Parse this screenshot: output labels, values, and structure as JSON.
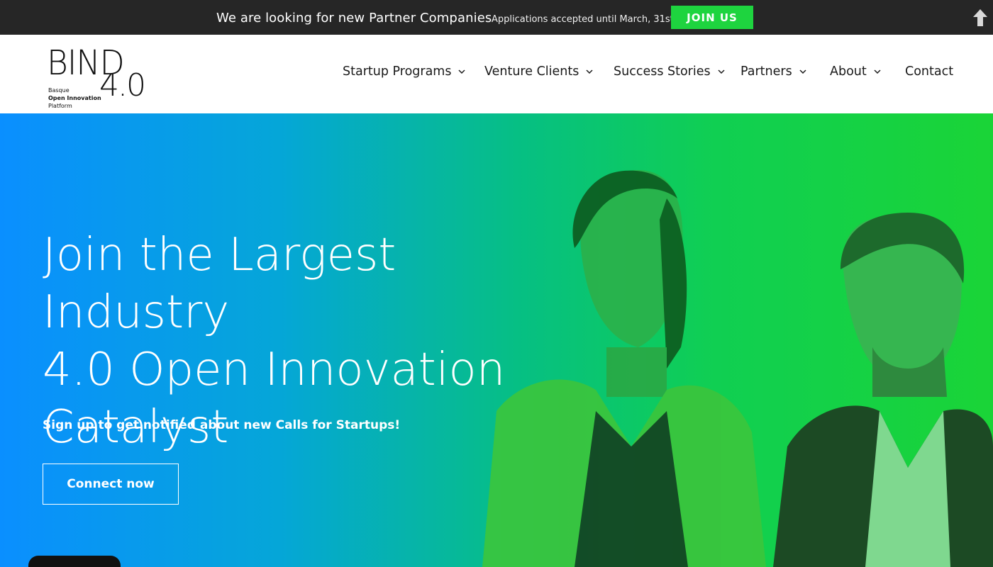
{
  "topbar": {
    "message": "We are looking for new Partner Companies",
    "sub_message": "Applications accepted until March, 31st",
    "join_label": "JOIN US",
    "up_icon": "arrow-up-icon"
  },
  "logo": {
    "word": "BIND",
    "version": "4.0",
    "line1": "Basque",
    "line2": "Open Innovation",
    "line3": "Platform"
  },
  "nav": {
    "items": [
      {
        "label": "Startup Programs",
        "dropdown": true
      },
      {
        "label": "Venture Clients",
        "dropdown": true
      },
      {
        "label": "Success Stories",
        "dropdown": true
      },
      {
        "label": "Partners",
        "dropdown": true
      },
      {
        "label": "About",
        "dropdown": true
      },
      {
        "label": "Contact",
        "dropdown": false
      }
    ]
  },
  "hero": {
    "title_line1": "Join the Largest Industry",
    "title_line2": "4.0 Open Innovation",
    "title_line3": "Catalyst",
    "tagline": "Sign up to get notified about new Calls for Startups!",
    "cta_label": "Connect now"
  },
  "colors": {
    "topbar_bg": "#262626",
    "join_green": "#1ed43f",
    "gradient_start": "#0a8fff",
    "gradient_end": "#1ad437"
  }
}
